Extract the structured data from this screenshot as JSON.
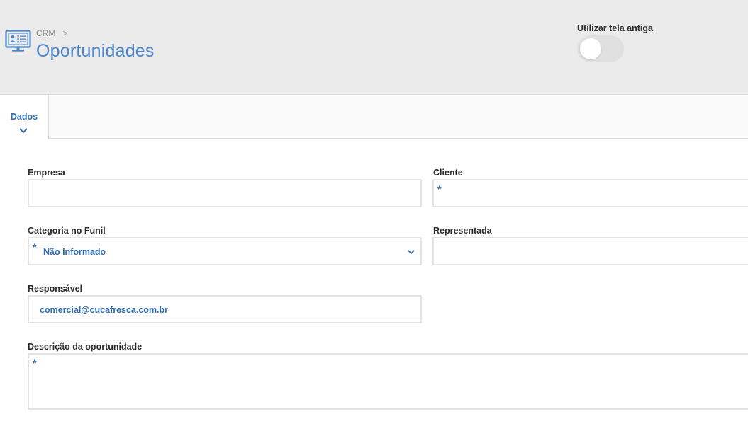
{
  "header": {
    "breadcrumb_root": "CRM",
    "breadcrumb_separator": ">",
    "title": "Oportunidades",
    "toggle_label": "Utilizar tela antiga",
    "toggle_on": false
  },
  "tabs": [
    {
      "label": "Dados",
      "active": true
    }
  ],
  "form": {
    "empresa": {
      "label": "Empresa",
      "value": ""
    },
    "cliente": {
      "label": "Cliente",
      "required_mark": "*",
      "value": ""
    },
    "categoria": {
      "label": "Categoria no Funil",
      "required_mark": "*",
      "value": "Não Informado"
    },
    "representada": {
      "label": "Representada",
      "value": ""
    },
    "responsavel": {
      "label": "Responsável",
      "value": "comercial@cucafresca.com.br"
    },
    "descricao": {
      "label": "Descrição da oportunidade",
      "required_mark": "*",
      "value": ""
    }
  },
  "colors": {
    "accent": "#4a86c8",
    "link": "#2f6db5",
    "header_bg": "#ebebeb"
  },
  "icons": {
    "app": "monitor-contact-card-icon",
    "breadcrumb": "chevron-right-icon",
    "tab": "chevron-down-icon",
    "select": "chevron-down-icon"
  }
}
